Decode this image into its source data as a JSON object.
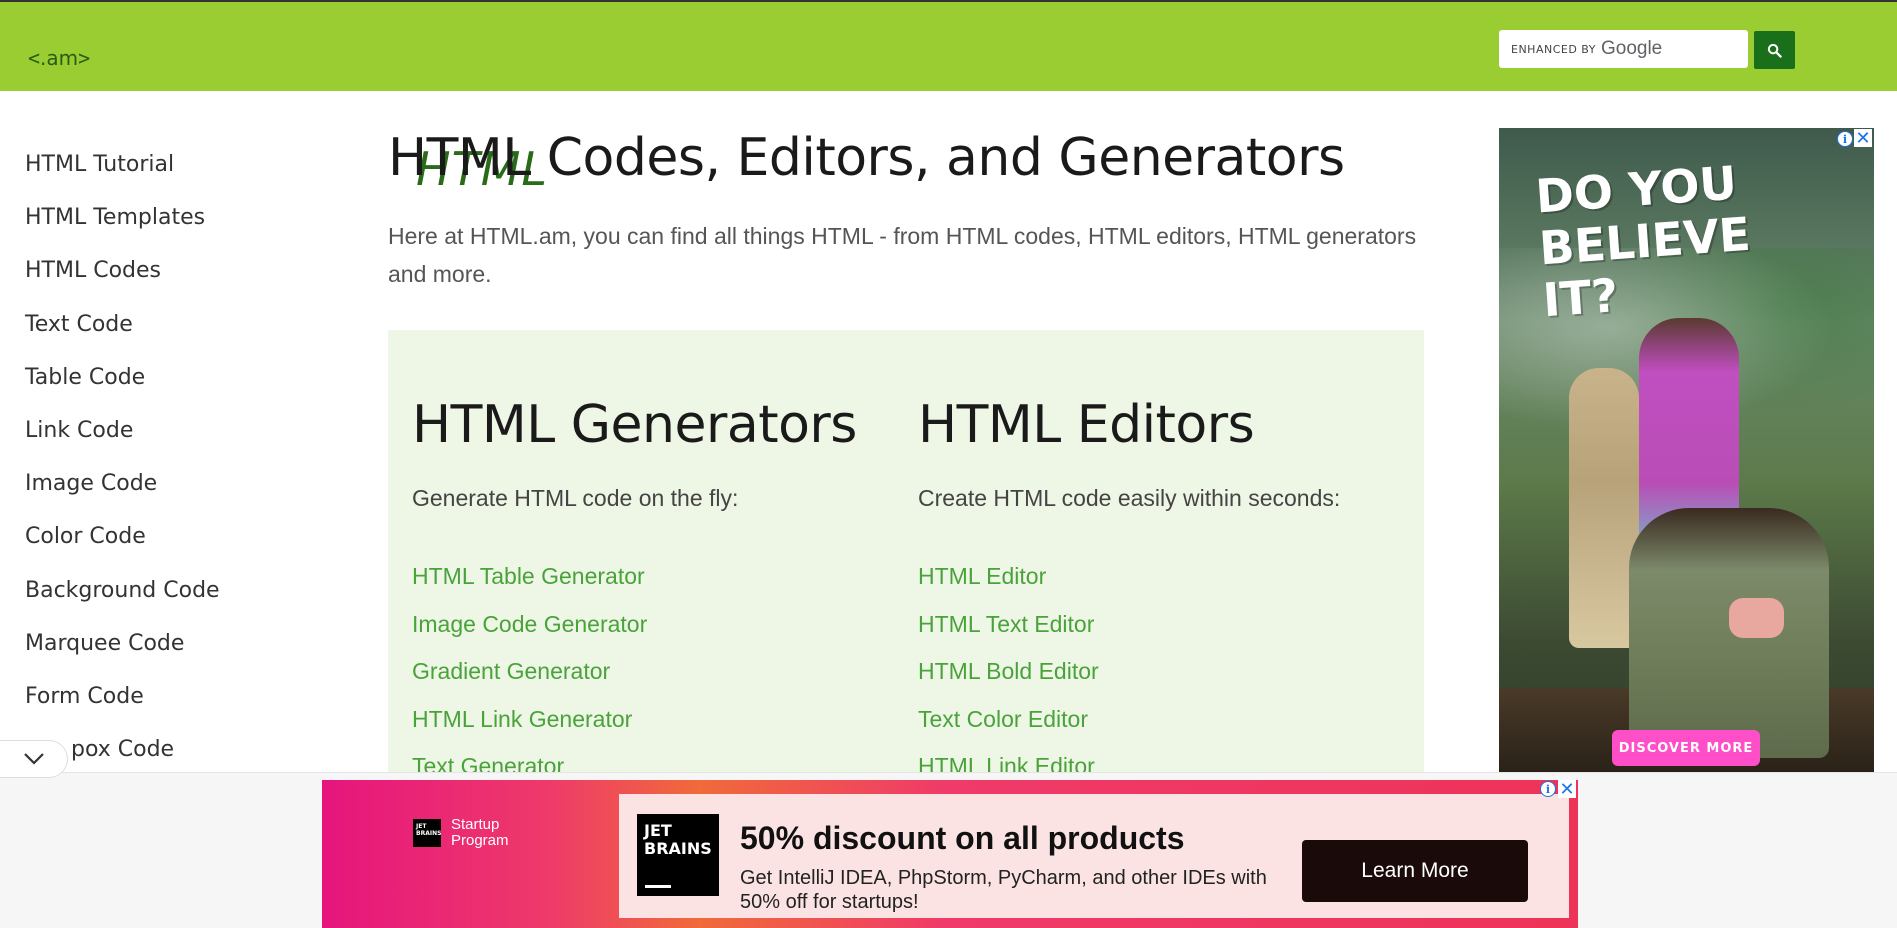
{
  "header": {
    "logo": {
      "lt": "<",
      "main": "HTML",
      "tld": ".am",
      "gt": ">"
    },
    "search": {
      "enhanced_label": "ENHANCED BY",
      "google_label": "Google",
      "placeholder": ""
    }
  },
  "sidebar": {
    "items": [
      {
        "label": "HTML Tutorial"
      },
      {
        "label": "HTML Templates"
      },
      {
        "label": "HTML Codes"
      },
      {
        "label": "Text Code"
      },
      {
        "label": "Table Code"
      },
      {
        "label": "Link Code"
      },
      {
        "label": "Image Code"
      },
      {
        "label": "Color Code"
      },
      {
        "label": "Background Code"
      },
      {
        "label": "Marquee Code"
      },
      {
        "label": "Form Code"
      },
      {
        "label": "pox Code"
      }
    ]
  },
  "main": {
    "title": "HTML Codes, Editors, and Generators",
    "intro": "Here at HTML.am, you can find all things HTML - from HTML codes, HTML editors, HTML generators and more.",
    "generators": {
      "heading": "HTML Generators",
      "desc": "Generate HTML code on the fly:",
      "links": [
        "HTML Table Generator",
        "Image Code Generator",
        "Gradient Generator",
        "HTML Link Generator",
        "Text Generator"
      ]
    },
    "editors": {
      "heading": "HTML Editors",
      "desc": "Create HTML code easily within seconds:",
      "links": [
        "HTML Editor",
        "HTML Text Editor",
        "HTML Bold Editor",
        "Text Color Editor",
        "HTML Link Editor"
      ]
    }
  },
  "side_ad": {
    "headline": "DO YOU BELIEVE IT?",
    "cta": "DISCOVER MORE",
    "info": "i",
    "close": "✕"
  },
  "bottom_ad": {
    "small_mark": "JET BRAINS",
    "small_text_1": "Startup",
    "small_text_2": "Program",
    "logo_text": "JET BRAINS",
    "title": "50% discount on all products",
    "desc": "Get IntelliJ IDEA, PhpStorm, PyCharm, and other IDEs with 50% off for startups!",
    "button": "Learn More",
    "info": "i",
    "close": "✕"
  },
  "colors": {
    "header_bg": "#9acd32",
    "link_green": "#4aa33a",
    "panel_bg": "#eef6e6",
    "search_button": "#1a6f1a"
  }
}
